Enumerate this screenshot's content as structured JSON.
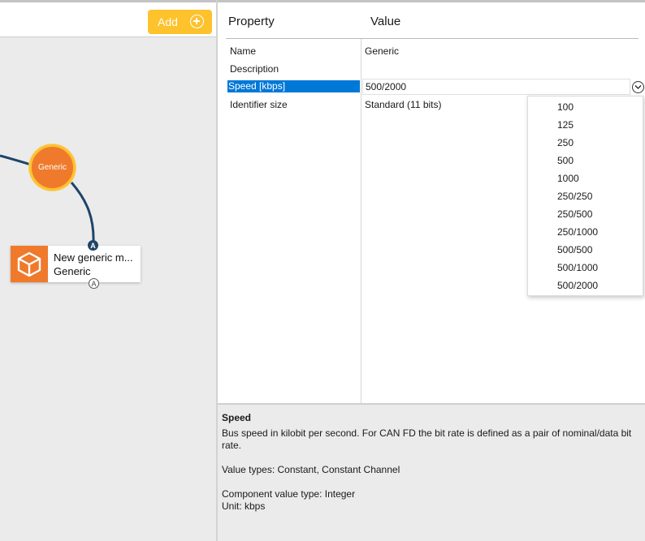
{
  "toolbar": {
    "add_label": "Add"
  },
  "diagram": {
    "bus_node_label": "Generic",
    "module": {
      "title": "New generic m...",
      "subtitle": "Generic"
    },
    "port_top_label": "A",
    "port_bottom_label": "A"
  },
  "properties": {
    "headers": {
      "property": "Property",
      "value": "Value"
    },
    "rows": [
      {
        "name": "Name",
        "value": "Generic"
      },
      {
        "name": "Description",
        "value": ""
      },
      {
        "name": "Speed [kbps]",
        "value": "500/2000"
      },
      {
        "name": "Identifier size",
        "value": "Standard (11 bits)"
      }
    ],
    "speed_options": [
      "100",
      "125",
      "250",
      "500",
      "1000",
      "250/250",
      "250/500",
      "250/1000",
      "500/500",
      "500/1000",
      "500/2000"
    ]
  },
  "description": {
    "title": "Speed",
    "line1": "Bus speed in kilobit per second. For CAN FD the bit rate is defined as a pair of nominal/data bit rate.",
    "line2": "Value types: Constant, Constant Channel",
    "line3": "Component value type: Integer",
    "line4": "Unit: kbps"
  },
  "colors": {
    "accent_yellow": "#fdc22c",
    "node_orange": "#ef7a2c",
    "wire_navy": "#1f4468",
    "selection_blue": "#0078d7"
  }
}
